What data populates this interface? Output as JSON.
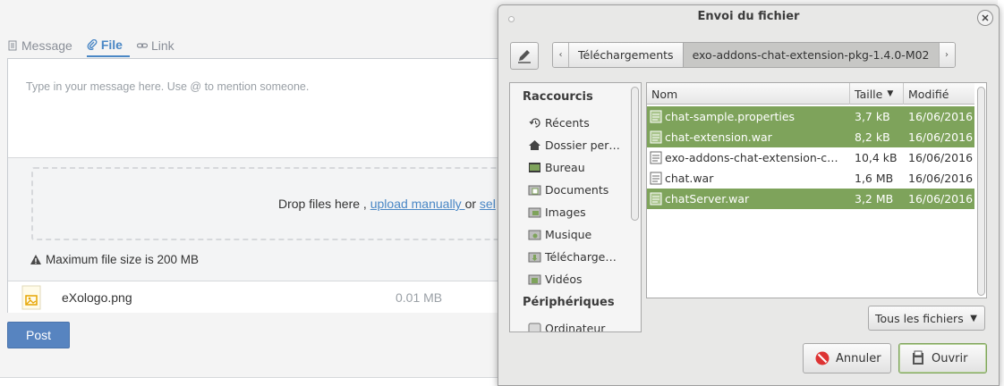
{
  "app": {
    "tabs": [
      {
        "label": "Message",
        "icon": "document-icon"
      },
      {
        "label": "File",
        "icon": "paperclip-icon"
      },
      {
        "label": "Link",
        "icon": "link-icon"
      }
    ],
    "message_placeholder": "Type in your message here. Use @ to mention someone.",
    "drop_text": "Drop files here , ",
    "upload_link": "upload manually ",
    "drop_or": "or ",
    "select_link": "sel",
    "max_size": "Maximum file size is 200 MB",
    "attached_file": {
      "name": "eXologo.png",
      "size": "0.01 MB"
    },
    "post_button": "Post",
    "accent_color": "#4a87c5"
  },
  "dialog": {
    "title": "Envoi du fichier",
    "path": [
      "Téléchargements",
      "exo-addons-chat-extension-pkg-1.4.0-M02"
    ],
    "places": {
      "shortcuts_heading": "Raccourcis",
      "items": [
        {
          "label": "Récents",
          "icon": "recent-icon"
        },
        {
          "label": "Dossier per…",
          "icon": "home-icon"
        },
        {
          "label": "Bureau",
          "icon": "desktop-icon"
        },
        {
          "label": "Documents",
          "icon": "folder-documents-icon"
        },
        {
          "label": "Images",
          "icon": "folder-images-icon"
        },
        {
          "label": "Musique",
          "icon": "folder-music-icon"
        },
        {
          "label": "Télécharge…",
          "icon": "folder-download-icon"
        },
        {
          "label": "Vidéos",
          "icon": "folder-videos-icon"
        }
      ],
      "devices_heading": "Périphériques",
      "devices": [
        {
          "label": "Ordinateur",
          "icon": "computer-icon"
        }
      ]
    },
    "columns": {
      "name": "Nom",
      "size": "Taille",
      "modified": "Modifié"
    },
    "files": [
      {
        "name": "chat-sample.properties",
        "size": "3,7 kB",
        "modified": "16/06/2016",
        "selected": true
      },
      {
        "name": "chat-extension.war",
        "size": "8,2 kB",
        "modified": "16/06/2016",
        "selected": true
      },
      {
        "name": "exo-addons-chat-extension-c…",
        "size": "10,4 kB",
        "modified": "16/06/2016",
        "selected": false
      },
      {
        "name": "chat.war",
        "size": "1,6 MB",
        "modified": "16/06/2016",
        "selected": false
      },
      {
        "name": "chatServer.war",
        "size": "3,2 MB",
        "modified": "16/06/2016",
        "selected": true
      }
    ],
    "filter": "Tous les fichiers",
    "cancel_button": "Annuler",
    "open_button": "Ouvrir",
    "selection_color": "#7ea35b"
  }
}
